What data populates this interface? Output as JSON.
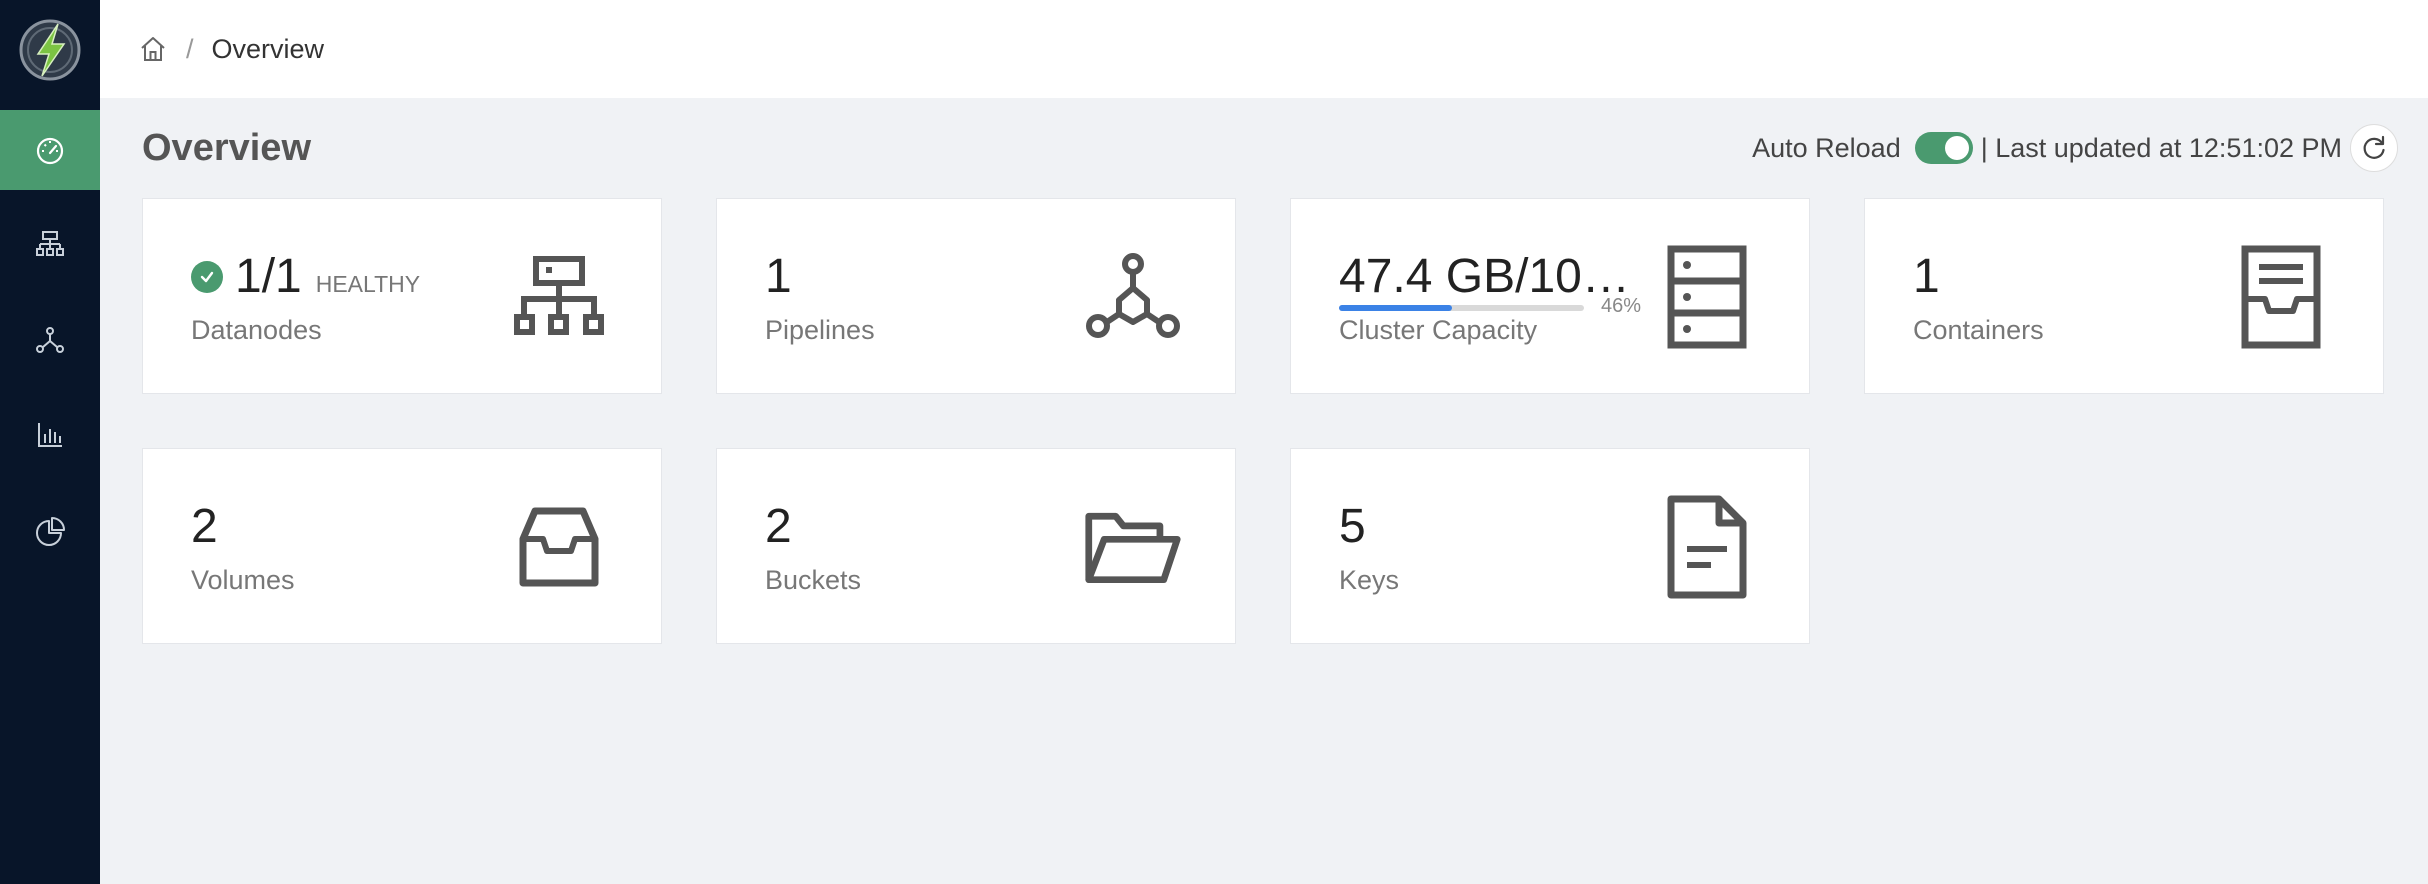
{
  "breadcrumb": {
    "current": "Overview"
  },
  "page": {
    "title": "Overview"
  },
  "reload": {
    "label": "Auto Reload",
    "enabled": true,
    "last_updated": "| Last updated at 12:51:02 PM"
  },
  "sidebar": {
    "items": [
      {
        "icon": "dashboard-icon",
        "active": true
      },
      {
        "icon": "cluster-icon",
        "active": false
      },
      {
        "icon": "pipeline-icon",
        "active": false
      },
      {
        "icon": "bar-chart-icon",
        "active": false
      },
      {
        "icon": "pie-chart-icon",
        "active": false
      }
    ]
  },
  "cards": {
    "datanodes": {
      "value": "1/1",
      "status": "HEALTHY",
      "label": "Datanodes",
      "icon": "sitemap-icon"
    },
    "pipelines": {
      "value": "1",
      "label": "Pipelines",
      "icon": "pipeline-icon"
    },
    "capacity": {
      "value": "47.4 GB/102...",
      "percent_text": "46%",
      "percent": 46,
      "label": "Cluster Capacity",
      "icon": "server-icon"
    },
    "containers": {
      "value": "1",
      "label": "Containers",
      "icon": "container-icon"
    },
    "volumes": {
      "value": "2",
      "label": "Volumes",
      "icon": "inbox-icon"
    },
    "buckets": {
      "value": "2",
      "label": "Buckets",
      "icon": "folder-open-icon"
    },
    "keys": {
      "value": "5",
      "label": "Keys",
      "icon": "file-icon"
    }
  },
  "colors": {
    "sidebar_bg": "#081529",
    "accent_green": "#4a9a6f",
    "progress_blue": "#3b82e6",
    "page_bg": "#f0f2f5"
  }
}
